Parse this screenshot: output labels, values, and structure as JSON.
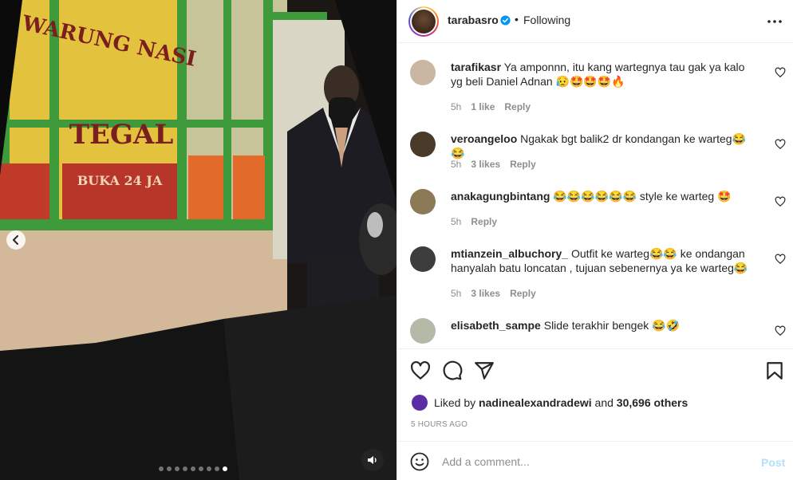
{
  "colors": {
    "accent": "#0095f6",
    "post_disabled": "#b2dffc",
    "muted": "#8e8e8e",
    "like_avatar": "#5b2ea6"
  },
  "media": {
    "sign_lines": [
      "WARUNG NASI",
      "TEGAL",
      "BUKA 24 JA"
    ],
    "carousel": {
      "total": 9,
      "active_index": 8
    },
    "icons": {
      "prev": "chevron-left-icon",
      "sound": "speaker-icon"
    }
  },
  "header": {
    "username": "tarabasro",
    "separator": "•",
    "follow_status": "Following",
    "icons": {
      "verified": "verified-badge-icon",
      "more": "more-options-icon"
    }
  },
  "comments": [
    {
      "username": "tarafikasr",
      "text": "Ya amponnn, itu kang wartegnya tau gak ya kalo yg beli Daniel Adnan 😥🤩🤩🤩🔥",
      "time": "5h",
      "likes": "1 like",
      "reply": "Reply",
      "avatar_color": "#c9b7a3"
    },
    {
      "username": "veroangeloo",
      "text": "Ngakak bgt balik2 dr kondangan ke warteg😂😂",
      "time": "5h",
      "likes": "3 likes",
      "reply": "Reply",
      "avatar_color": "#4a3a2a"
    },
    {
      "username": "anakagungbintang",
      "text": "😂😂😂😂😂😂 style ke warteg 🤩",
      "time": "5h",
      "likes": "",
      "reply": "Reply",
      "avatar_color": "#8c7a56"
    },
    {
      "username": "mtianzein_albuchory_",
      "text": "Outfit ke warteg😂😂 ke ondangan hanyalah batu loncatan , tujuan sebenernya ya ke warteg😂",
      "time": "5h",
      "likes": "3 likes",
      "reply": "Reply",
      "avatar_color": "#3d3d3d"
    },
    {
      "username": "elisabeth_sampe",
      "text": "Slide terakhir bengek 😂🤣",
      "time": "",
      "likes": "",
      "reply": "",
      "avatar_color": "#b5b9a8"
    }
  ],
  "actions": {
    "icons": {
      "like": "heart-icon",
      "comment": "comment-icon",
      "share": "share-icon",
      "save": "bookmark-icon"
    },
    "liked_prefix": "Liked by",
    "liked_user": "nadinealexandradewi",
    "liked_and": "and",
    "liked_others": "30,696 others",
    "timestamp": "5 HOURS AGO"
  },
  "composer": {
    "placeholder": "Add a comment...",
    "post_label": "Post",
    "icons": {
      "emoji": "emoji-icon"
    }
  }
}
